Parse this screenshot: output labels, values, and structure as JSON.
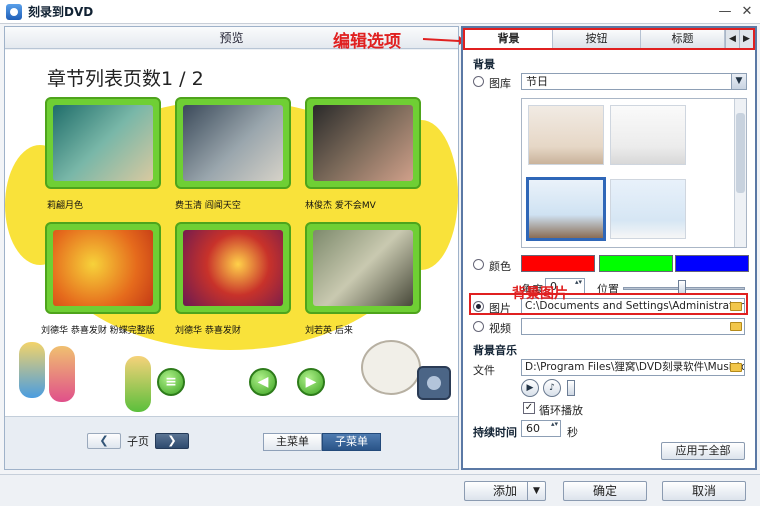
{
  "window": {
    "title": "刻录到DVD"
  },
  "preview": {
    "header": "预览",
    "menu_title": "章节列表页数1 / 2",
    "thumbnails": [
      {
        "label": "莉翩月色"
      },
      {
        "label": "费玉清 阎闻天空"
      },
      {
        "label": "林俊杰 爱不会MV"
      },
      {
        "label": "刘德华 恭喜发财 粉蝶完整版"
      },
      {
        "label": "刘德华 恭喜发财"
      },
      {
        "label": "刘若英 后来"
      }
    ],
    "footer": {
      "sub_page_label": "子页",
      "main_menu_label": "主菜单",
      "sub_menu_label": "子菜单"
    }
  },
  "annotations": {
    "edit_options": "编辑选项",
    "background_image": "背景图片"
  },
  "panel": {
    "tabs": [
      "背景",
      "按钮",
      "标题"
    ],
    "background": {
      "section_title": "背景",
      "library_label": "图库",
      "library_value": "节日",
      "color_label": "颜色",
      "colors": [
        "#ff0000",
        "#00ff00",
        "#0000ff"
      ],
      "angle_label": "角度",
      "angle_value": "0",
      "position_label": "位置",
      "image_label": "图片",
      "image_path": "C:\\Documents and Settings\\Administrator\\桌面",
      "video_label": "视频",
      "video_path": ""
    },
    "music": {
      "section_title": "背景音乐",
      "file_label": "文件",
      "file_path": "D:\\Program Files\\狸窝\\DVD刻录软件\\Music\\defa",
      "loop_label": "循环播放",
      "loop_checked": true
    },
    "duration": {
      "label": "持续时间",
      "value": "60",
      "unit": "秒"
    },
    "apply_all": "应用于全部"
  },
  "bottom": {
    "add": "添加",
    "ok": "确定",
    "cancel": "取消"
  }
}
